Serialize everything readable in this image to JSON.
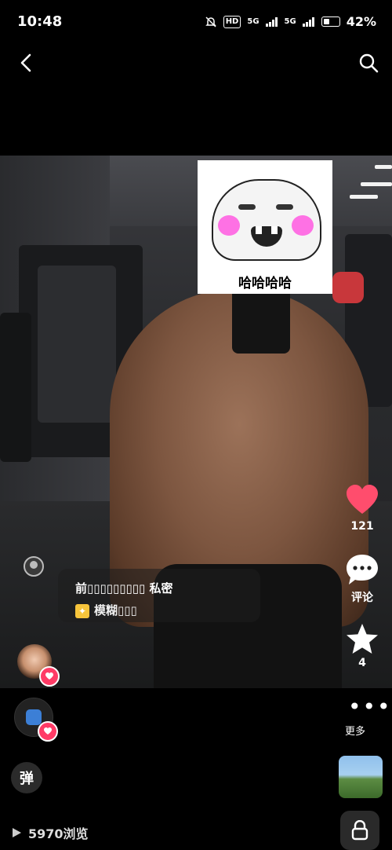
{
  "status_bar": {
    "time": "10:48",
    "hd": "HD",
    "signal1": "5G",
    "signal2": "5G",
    "battery": "42%"
  },
  "photo": {
    "sticker_text": "哈哈哈哈",
    "overlay_line1": "前▯▯▯▯▯▯▯▯▯ 私密",
    "overlay_line2": "模糊▯▯▯"
  },
  "side_actions": {
    "like_count": "121",
    "comment_label": "评论",
    "favorite_count": "4",
    "more_label": "更多"
  },
  "bottom": {
    "danmu_label": "弹",
    "views": "5970浏览"
  },
  "icons": {
    "back": "chevron-left-icon",
    "search": "search-icon",
    "heart": "heart-icon",
    "comment": "comment-bubble-icon",
    "star": "star-icon",
    "lock": "lock-icon"
  },
  "colors": {
    "like": "#ff4d6d",
    "badge": "#ff3b66"
  }
}
